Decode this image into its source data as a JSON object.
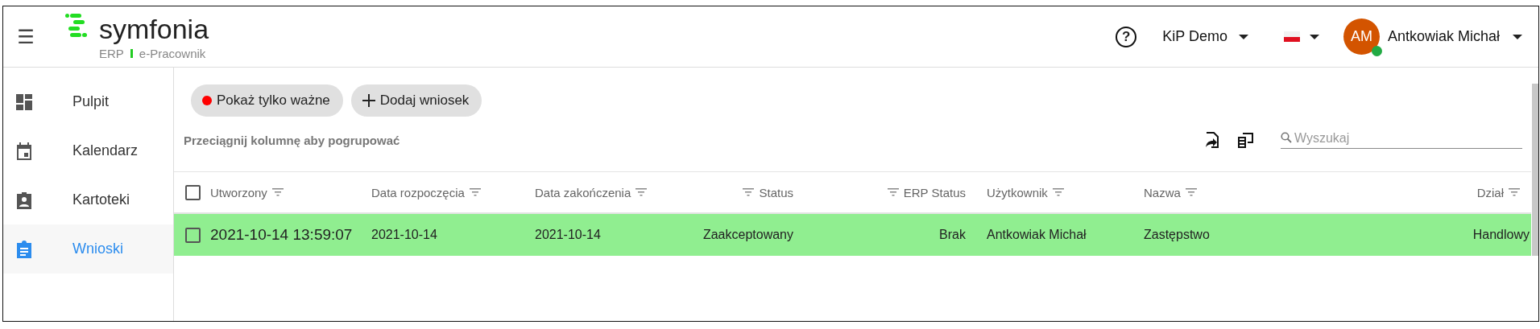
{
  "header": {
    "menu_icon": "☰",
    "logo": {
      "name": "symfonia",
      "product": "ERP",
      "module": "e-Pracownik"
    },
    "help_icon": "?",
    "company": "KiP Demo",
    "language": {
      "kind": "flag"
    },
    "user": {
      "initials": "AM",
      "name": "Antkowiak Michał",
      "online": true
    }
  },
  "sidebar": {
    "items": [
      {
        "label": "Pulpit",
        "selected": false
      },
      {
        "label": "Kalendarz",
        "selected": false
      },
      {
        "label": "Kartoteki",
        "selected": false
      },
      {
        "label": "Wnioski",
        "selected": true
      }
    ]
  },
  "toolbar": {
    "buttons": [
      {
        "label": "Pokaż tylko ważne",
        "kind": "dot"
      },
      {
        "label": "Dodaj wniosek",
        "kind": "plus"
      }
    ],
    "group_hint": "Przeciągnij kolumnę aby pogrupować",
    "search": {
      "placeholder": "Wyszukaj"
    }
  },
  "table": {
    "columns": [
      {
        "label": "Utworzony"
      },
      {
        "label": "Data rozpoczęcia"
      },
      {
        "label": "Data zakończenia"
      },
      {
        "label": "Status"
      },
      {
        "label": "ERP Status"
      },
      {
        "label": "Użytkownik"
      },
      {
        "label": "Nazwa"
      },
      {
        "label": "Dział"
      }
    ],
    "header_checked": false,
    "rows": [
      {
        "checked": false,
        "color": "#90ee90",
        "cells": [
          "2021-10-14 13:59:07",
          "2021-10-14",
          "2021-10-14",
          "Zaakceptowany",
          "Brak",
          "Antkowiak Michał",
          "Zastępstwo",
          "Handlowy"
        ]
      }
    ]
  }
}
